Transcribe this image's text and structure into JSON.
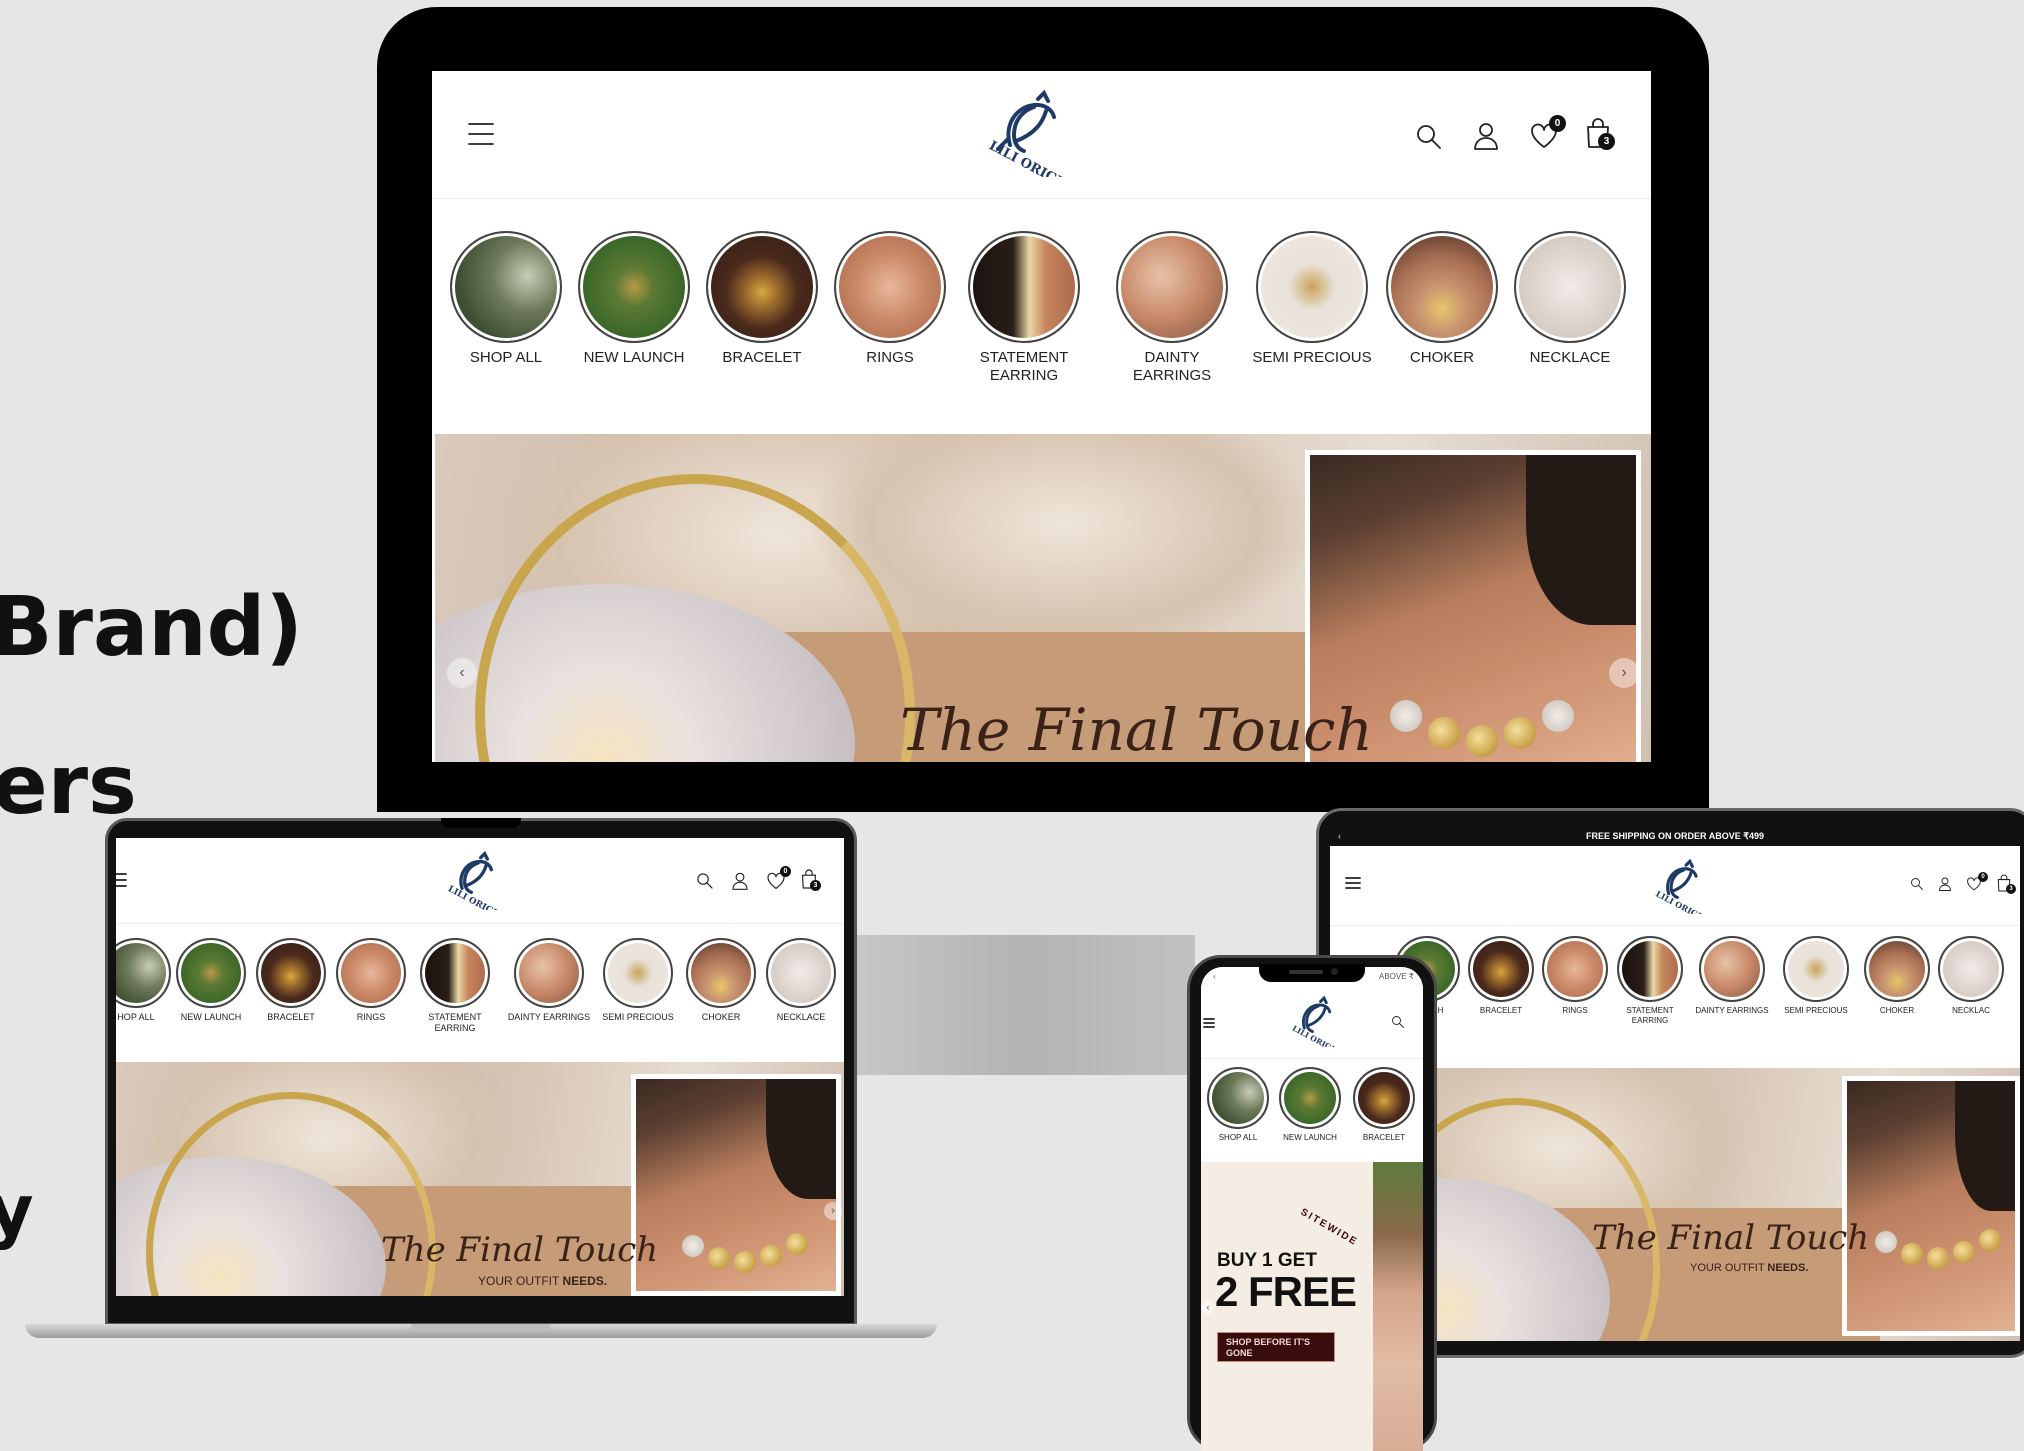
{
  "background_text": {
    "line1": "Brand)",
    "line2": "ers",
    "line3": "y"
  },
  "brand": {
    "name": "LILI ORIGIN",
    "color": "#1e3a66"
  },
  "header": {
    "wishlist_count": "0",
    "cart_count": "3",
    "announcement": "FREE SHIPPING ON ORDER ABOVE ₹499",
    "announcement_mobile": "ABOVE ₹"
  },
  "categories": [
    {
      "label": "SHOP ALL",
      "label_short": "HOP ALL"
    },
    {
      "label": "NEW LAUNCH",
      "label_short": "LAUNCH"
    },
    {
      "label": "BRACELET"
    },
    {
      "label": "RINGS"
    },
    {
      "label": "STATEMENT EARRING"
    },
    {
      "label": "DAINTY EARRINGS"
    },
    {
      "label": "SEMI PRECIOUS"
    },
    {
      "label": "CHOKER"
    },
    {
      "label": "NECKLACE",
      "label_short": "NECKLAC"
    }
  ],
  "banner": {
    "title": "The Final Touch",
    "subtitle_plain": "YOUR OUTFIT ",
    "subtitle_bold": "NEEDS."
  },
  "promo": {
    "sitewide": "SITEWIDE",
    "line1": "BUY 1 GET",
    "line2": "2 FREE",
    "cta": "SHOP BEFORE IT'S GONE"
  },
  "colors": {
    "page_bg": "#e6e6e6",
    "bezel": "#000000",
    "banner_tan": "#c59b78",
    "promo_button": "#3a0d0d"
  }
}
